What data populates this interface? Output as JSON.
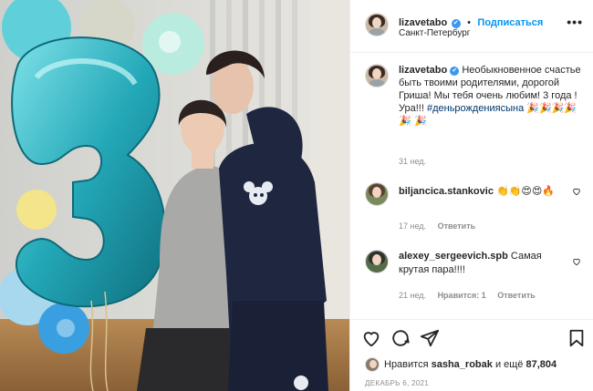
{
  "post": {
    "username": "lizavetabo",
    "verified_mark": "✔",
    "separator": "•",
    "follow_label": "Подписаться",
    "location": "Санкт-Петербург",
    "more_icon": "more-dots-icon"
  },
  "caption": {
    "username": "lizavetabo",
    "text": "Необыкновенное счастье быть твоими родителями, дорогой Гриша! Мы тебя очень любим! 3 года ! Ура!!!",
    "hashtag": "#деньрождениясына",
    "emojis": "🎉🎉🎉🎉🎉 🎉",
    "time": "31 нед."
  },
  "comments": [
    {
      "username": "biljancica.stankovic",
      "text": "👏👏😍😍🔥",
      "time": "17 нед.",
      "reply_label": "Ответить",
      "likes_label": ""
    },
    {
      "username": "alexey_sergeevich.spb",
      "text": "Самая крутая пара!!!!",
      "time": "21 нед.",
      "likes_label": "Нравится: 1",
      "reply_label": "Ответить"
    }
  ],
  "likes": {
    "prefix": "Нравится",
    "user": "sasha_robak",
    "middle": "и ещё",
    "count": "87,804"
  },
  "date": "ДЕКАБРЬ 6, 2021",
  "icons": {
    "like": "heart-icon",
    "comment": "comment-icon",
    "share": "share-icon",
    "save": "bookmark-icon"
  },
  "colors": {
    "link_blue": "#0095f6",
    "hashtag": "#00376b",
    "verified": "#3897f0",
    "muted": "#8e8e8e",
    "balloon_teal": "#2bb6c4",
    "hoodie_navy": "#1f2740"
  }
}
